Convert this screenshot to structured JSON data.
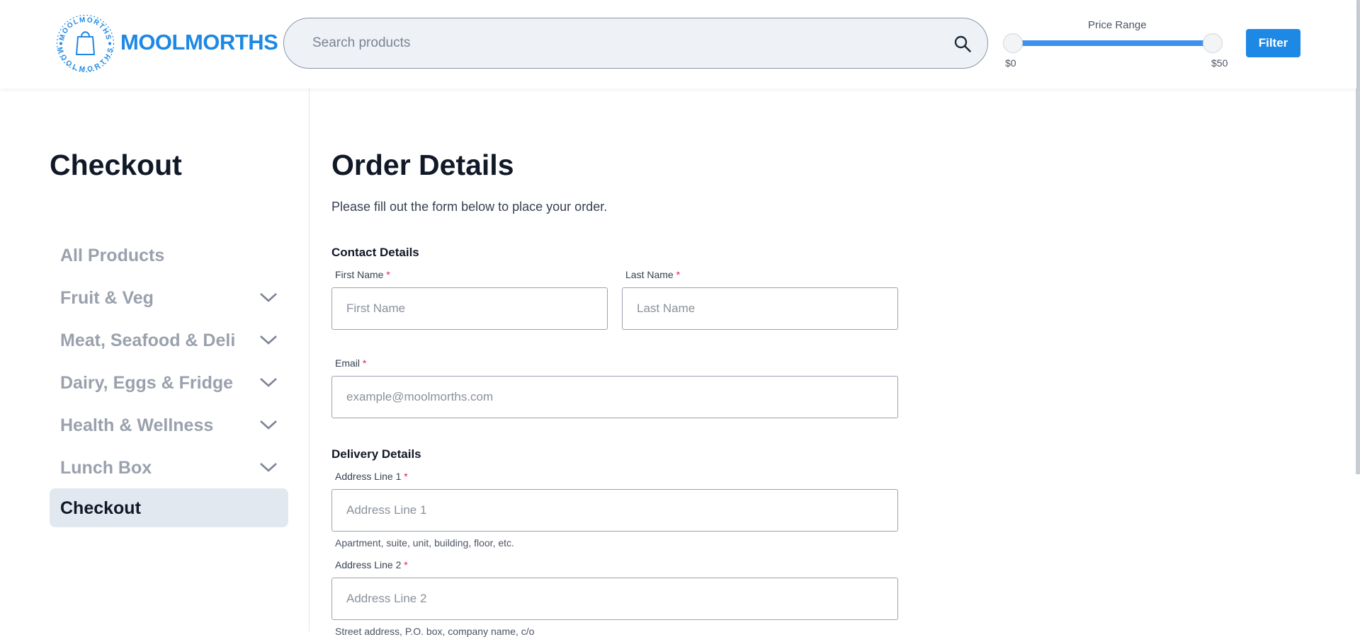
{
  "header": {
    "brand": "MOOLMORTHS",
    "search_placeholder": "Search products",
    "price_range": {
      "label": "Price Range",
      "min_label": "$0",
      "max_label": "$50",
      "min_value": 0,
      "max_value": 50
    },
    "filter_label": "Filter",
    "accent_color": "#1e88e5"
  },
  "sidebar": {
    "title": "Checkout",
    "items": [
      {
        "label": "All Products",
        "icon": null
      },
      {
        "label": "Fruit & Veg",
        "icon": "chevron-down-icon"
      },
      {
        "label": "Meat, Seafood & Deli",
        "icon": "chevron-down-icon"
      },
      {
        "label": "Dairy, Eggs & Fridge",
        "icon": "chevron-down-icon"
      },
      {
        "label": "Health & Wellness",
        "icon": "chevron-down-icon"
      },
      {
        "label": "Lunch Box",
        "icon": "chevron-down-icon"
      },
      {
        "label": "Checkout",
        "icon": null,
        "active": true
      }
    ]
  },
  "main": {
    "title": "Order Details",
    "intro": "Please fill out the form below to place your order.",
    "contact": {
      "heading": "Contact Details",
      "first_name": {
        "label": "First Name",
        "placeholder": "First Name",
        "required": "*"
      },
      "last_name": {
        "label": "Last Name",
        "placeholder": "Last Name",
        "required": "*"
      },
      "email": {
        "label": "Email",
        "placeholder": "example@moolmorths.com",
        "required": "*"
      }
    },
    "delivery": {
      "heading": "Delivery Details",
      "address1": {
        "label": "Address Line 1",
        "placeholder": "Address Line 1",
        "required": "*",
        "hint": "Apartment, suite, unit, building, floor, etc."
      },
      "address2": {
        "label": "Address Line 2",
        "placeholder": "Address Line 2",
        "required": "*",
        "hint": "Street address, P.O. box, company name, c/o"
      }
    }
  }
}
